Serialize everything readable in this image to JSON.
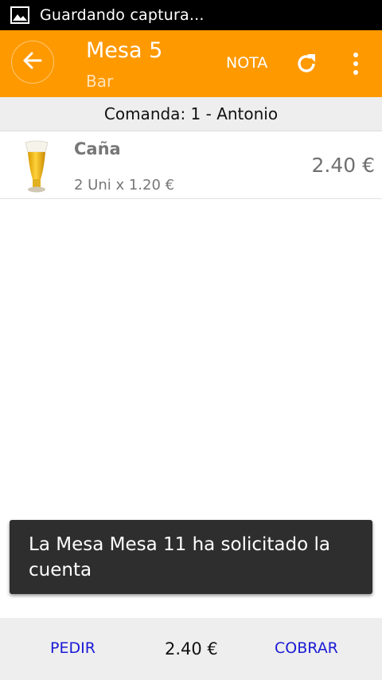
{
  "status_bar": {
    "notification_icon": "image-icon",
    "text": "Guardando captura..."
  },
  "action_bar": {
    "back_icon": "arrow-left-icon",
    "title": "Mesa 5",
    "subtitle": "Bar",
    "nota_label": "NOTA",
    "refresh_icon": "refresh-icon",
    "menu_icon": "more-vertical-icon",
    "background_color": "#ff9900"
  },
  "comanda": {
    "label": "Comanda: 1 - Antonio"
  },
  "items": [
    {
      "image_icon": "beer-glass-icon",
      "name": "Caña",
      "quantity": "2 Uni x 1.20 €",
      "price": "2.40 €"
    }
  ],
  "toast": {
    "message": "La Mesa Mesa 11 ha solicitado la cuenta"
  },
  "bottom_bar": {
    "pedir_label": "PEDIR",
    "total": "2.40 €",
    "cobrar_label": "COBRAR",
    "link_color": "#1a1ad6"
  }
}
